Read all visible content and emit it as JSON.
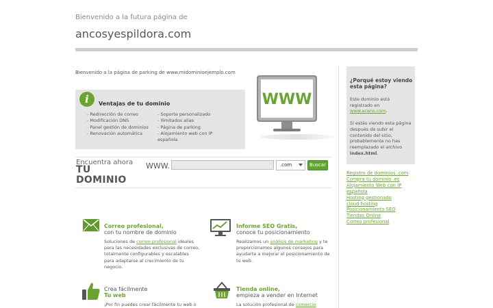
{
  "header": {
    "welcome": "Bienvenido a la futura página de",
    "domain": "ancosyespildora.com"
  },
  "intro": "Bienvenido a la página de parking de www.midominioejemplo.com",
  "advantages": {
    "title": "Ventajas de tu dominio",
    "col1": [
      "Redirección de correo",
      "Modificación DNS",
      "Panel gestión de dominios",
      "Renovación automática"
    ],
    "col2": [
      "Soporte personalizado",
      "Ilimitados alias",
      "Página de parking",
      "Alojamiento web con IP española"
    ]
  },
  "monitor": {
    "screen_text": "WWW",
    "accent": "#6aa332"
  },
  "search": {
    "pre": "Encuentra ahora",
    "big1": "TU",
    "big2": "DOMINIO",
    "www_label": "WWW.",
    "input_value": "",
    "tld": ".com",
    "button": "Buscar"
  },
  "features": {
    "correo": {
      "icon": "envelope-icon",
      "title": "Correo profesional,",
      "subtitle": "con tu nombre de dominio",
      "body_pre": "Soluciones de ",
      "body_link": "correo profesional",
      "body_post": " ideales para las necesidades exclusivas de correo, totalmente configurables y escalables para adaptarse al crecimiento de tu negocio."
    },
    "seo": {
      "icon": "monitor-chart-icon",
      "title": "Informe SEO Gratis,",
      "subtitle": "conoce tu posicionamiento",
      "body_pre": "Realizamos un ",
      "body_link": "análisis de marketing",
      "body_post": " y te proporcionamos algunos consejos para ayudarte a mejorar el posicionamiento de tu web."
    },
    "web": {
      "icon": "thumbs-up-icon",
      "title_pre": "Crea fácilmente",
      "title": "Tu web",
      "body": "¡Por fin puedes crear fácilmente tu web o"
    },
    "tienda": {
      "icon": "shopping-basket-icon",
      "title": "Tienda online,",
      "subtitle": "empieza a vender en Internet",
      "body_pre": "La solución profesional de ",
      "body_link": "comercio"
    }
  },
  "sidebar": {
    "why_title": "¿Porqué estoy viendo esta página?",
    "why_p1_pre": "Este dominio está registrado en",
    "why_p1_link": "www.acens.com",
    "why_p1_post": ".",
    "why_p2_pre": "Si estás viendo esta página después de subir el contenido del sitio, probablemente no has reemplazado el archivo",
    "why_p2_bold": "index.html",
    "why_p2_post": ".",
    "links": [
      "Registro de dominios .com",
      "Compra tu dominio .es",
      "Alojamiento Web con IP",
      "española",
      "Hosting gestionado",
      "cloud hosting",
      "Posicionamiento SEO",
      "Tiendas Online",
      "Correo profesional"
    ]
  },
  "colors": {
    "green": "#6aa332",
    "box_gray": "#e4e4e4",
    "bar_gray": "#cfcfcf"
  }
}
